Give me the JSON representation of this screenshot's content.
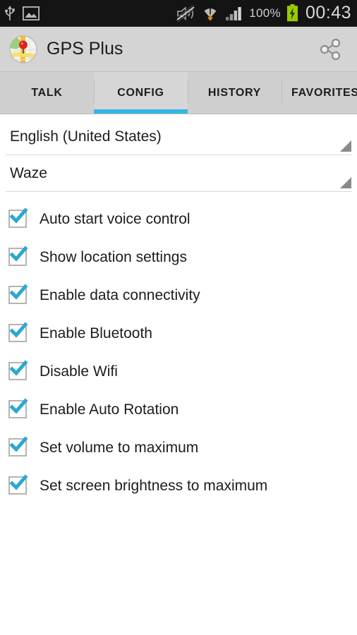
{
  "statusbar": {
    "left_icons": [
      "usb-icon",
      "screenshot-image-icon"
    ],
    "right_icons": [
      "mute-vibrate-off-icon",
      "wifi-download-icon",
      "signal-bars-icon",
      "battery-charging-icon"
    ],
    "battery_percent": "100%",
    "time": "00:43",
    "bg_color": "#141414",
    "text_color": "#d9d9d9",
    "battery_color": "#99cc00"
  },
  "appbar": {
    "icon": "gps-map-globe-icon",
    "title": "GPS Plus",
    "share_icon": "share-icon",
    "bg_color": "#d4d4d4"
  },
  "tabs": {
    "accent_color": "#33b5e5",
    "selected": "CONFIG",
    "items": [
      {
        "label": "TALK",
        "selected": false
      },
      {
        "label": "CONFIG",
        "selected": true
      },
      {
        "label": "HISTORY",
        "selected": false
      },
      {
        "label": "FAVORITES",
        "selected": false
      }
    ]
  },
  "spinners": [
    {
      "name": "language-spinner",
      "value": "English (United States)"
    },
    {
      "name": "navigation-app-spinner",
      "value": "Waze"
    }
  ],
  "checkboxes": {
    "check_color": "#2aa8d4",
    "items": [
      {
        "label": "Auto start voice control",
        "checked": true
      },
      {
        "label": "Show location settings",
        "checked": true
      },
      {
        "label": "Enable data connectivity",
        "checked": true
      },
      {
        "label": "Enable Bluetooth",
        "checked": true
      },
      {
        "label": "Disable Wifi",
        "checked": true
      },
      {
        "label": "Enable Auto Rotation",
        "checked": true
      },
      {
        "label": "Set volume to maximum",
        "checked": true
      },
      {
        "label": "Set screen brightness to maximum",
        "checked": true
      }
    ]
  }
}
